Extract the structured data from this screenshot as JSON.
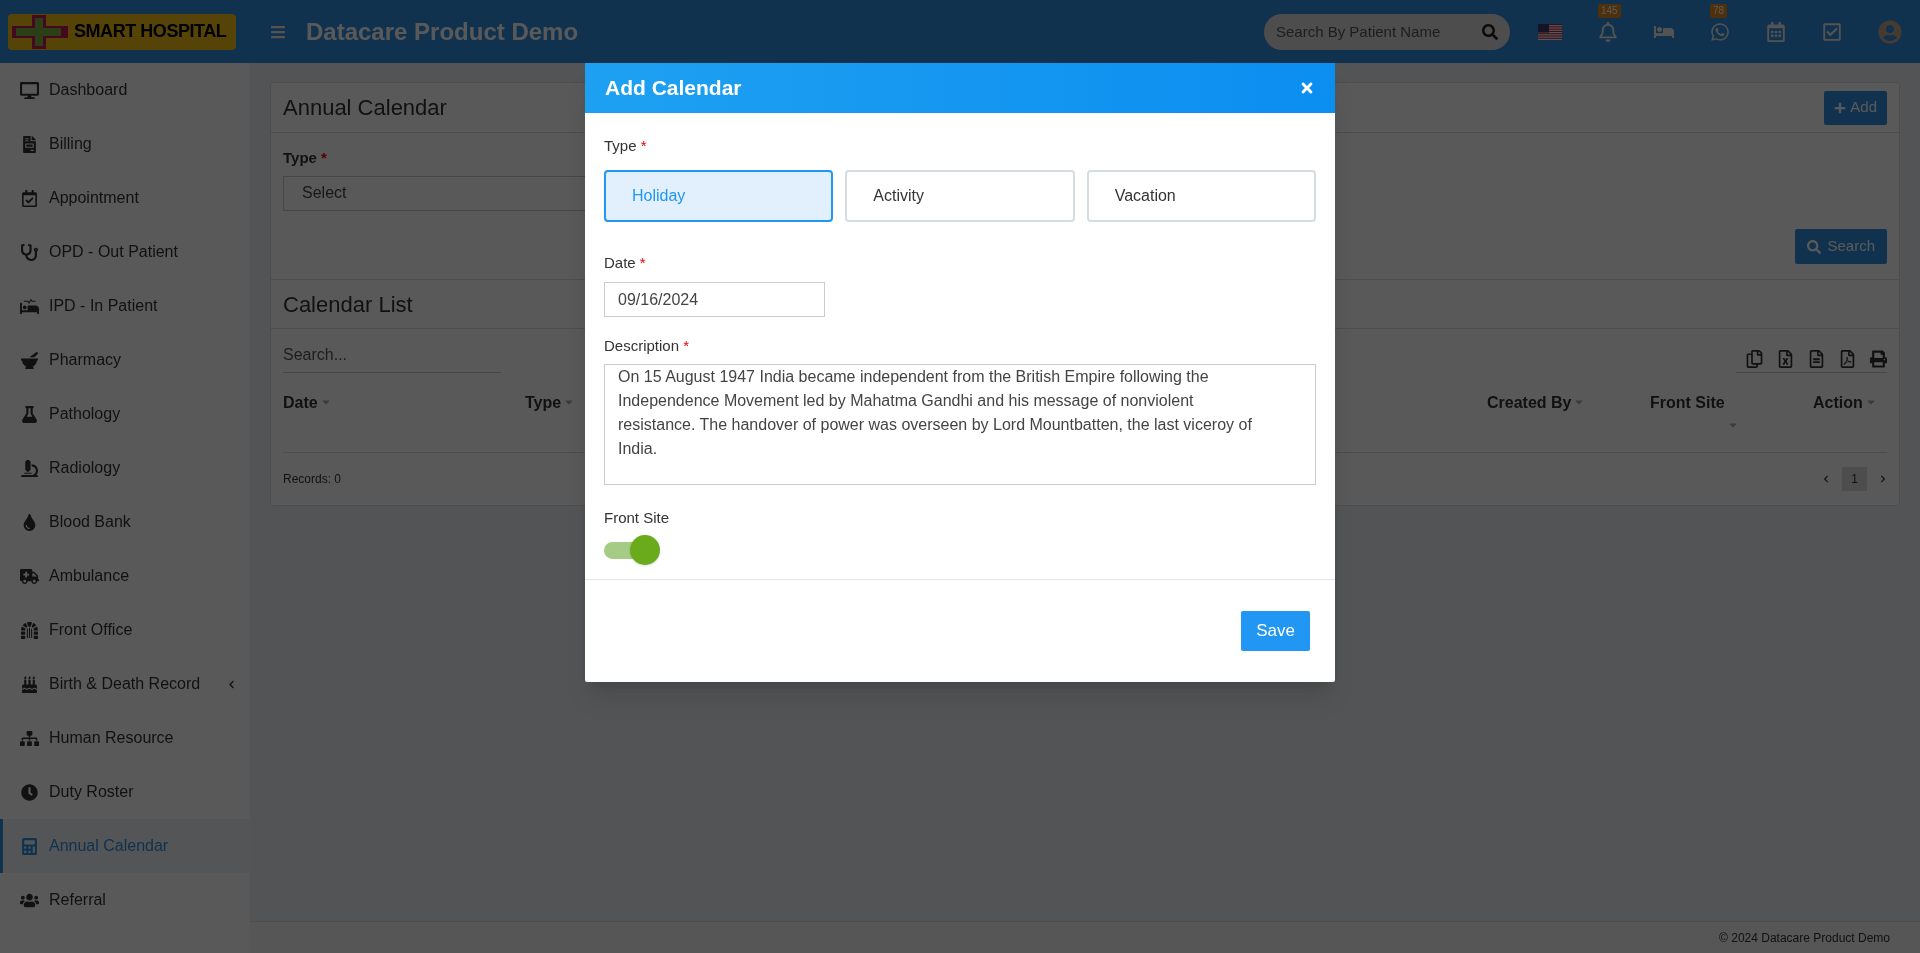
{
  "header": {
    "logo_text": "SMART HOSPITAL",
    "title": "Datacare Product Demo",
    "search_placeholder": "Search By Patient Name",
    "notification_count": "145",
    "whatsapp_count": "78"
  },
  "sidebar": {
    "items": [
      {
        "label": "Dashboard",
        "selected": false,
        "expandable": false
      },
      {
        "label": "Billing",
        "selected": false,
        "expandable": false
      },
      {
        "label": "Appointment",
        "selected": false,
        "expandable": false
      },
      {
        "label": "OPD - Out Patient",
        "selected": false,
        "expandable": false
      },
      {
        "label": "IPD - In Patient",
        "selected": false,
        "expandable": false
      },
      {
        "label": "Pharmacy",
        "selected": false,
        "expandable": false
      },
      {
        "label": "Pathology",
        "selected": false,
        "expandable": false
      },
      {
        "label": "Radiology",
        "selected": false,
        "expandable": false
      },
      {
        "label": "Blood Bank",
        "selected": false,
        "expandable": false
      },
      {
        "label": "Ambulance",
        "selected": false,
        "expandable": false
      },
      {
        "label": "Front Office",
        "selected": false,
        "expandable": false
      },
      {
        "label": "Birth & Death Record",
        "selected": false,
        "expandable": true
      },
      {
        "label": "Human Resource",
        "selected": false,
        "expandable": false
      },
      {
        "label": "Duty Roster",
        "selected": false,
        "expandable": false
      },
      {
        "label": "Annual Calendar",
        "selected": true,
        "expandable": false
      },
      {
        "label": "Referral",
        "selected": false,
        "expandable": false
      }
    ]
  },
  "required_mark": "*",
  "page": {
    "title": "Annual Calendar",
    "add_button": "Add",
    "type_label": "Type",
    "type_select": "Select",
    "search_button": "Search",
    "list_title": "Calendar List",
    "list_search_placeholder": "Search...",
    "columns_left": [
      "Date",
      "Type"
    ],
    "columns_right": [
      "Created By",
      "Front Site",
      "Action"
    ],
    "records": "Records: 0",
    "page_number": "1"
  },
  "modal": {
    "title": "Add Calendar",
    "type_label": "Type",
    "types": [
      {
        "label": "Holiday",
        "selected": true
      },
      {
        "label": "Activity",
        "selected": false
      },
      {
        "label": "Vacation",
        "selected": false
      }
    ],
    "date_label": "Date",
    "date_value": "09/16/2024",
    "description_label": "Description",
    "description_value": "On 15 August 1947 India became independent from the British Empire following the Independence Movement led by Mahatma Gandhi and his message of nonviolent resistance. The handover of power was overseen by Lord Mountbatten, the last viceroy of India.",
    "front_site_label": "Front Site",
    "front_site_on": true,
    "save_button": "Save"
  },
  "footer": {
    "text": "© 2024 Datacare Product Demo"
  }
}
